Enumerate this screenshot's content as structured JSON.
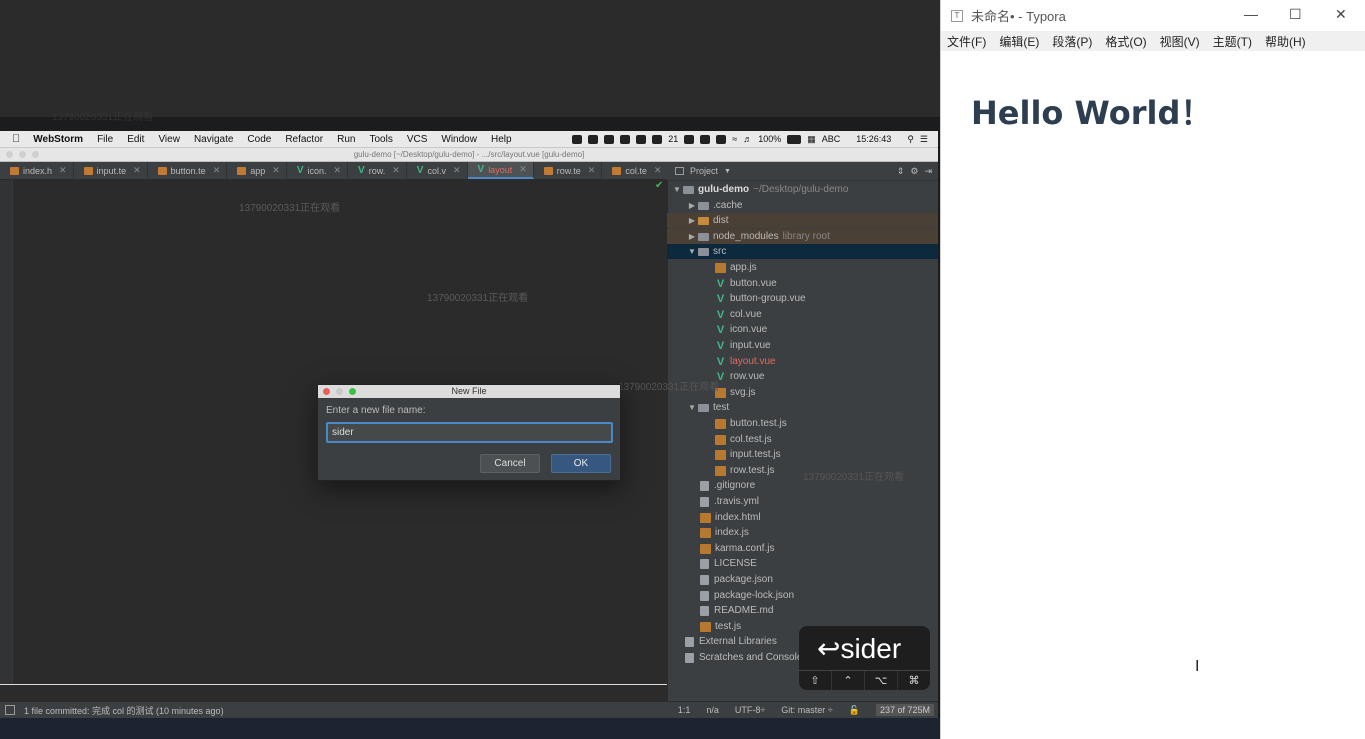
{
  "left_watermark_top": "13790020331正在观看",
  "mac_menubar": {
    "apple": "",
    "app_name": "WebStorm",
    "items": [
      "File",
      "Edit",
      "View",
      "Navigate",
      "Code",
      "Refactor",
      "Run",
      "Tools",
      "VCS",
      "Window",
      "Help"
    ],
    "tray_count": "21",
    "battery": "100%",
    "input_method": "ABC",
    "clock": "15:26:43"
  },
  "ws_window": {
    "title": "gulu-demo [~/Desktop/gulu-demo] - .../src/layout.vue [gulu-demo]"
  },
  "tabs": [
    {
      "label": "index.h",
      "icon": "js"
    },
    {
      "label": "input.te",
      "icon": "js"
    },
    {
      "label": "button.te",
      "icon": "js"
    },
    {
      "label": "app",
      "icon": "js"
    },
    {
      "label": "icon.",
      "icon": "vue"
    },
    {
      "label": "row.",
      "icon": "vue"
    },
    {
      "label": "col.v",
      "icon": "vue"
    },
    {
      "label": "layout",
      "icon": "vue",
      "active": true
    },
    {
      "label": "row.te",
      "icon": "js"
    },
    {
      "label": "col.te",
      "icon": "js"
    }
  ],
  "editor_watermarks": [
    "13790020331正在观看",
    "13790020331正在观看",
    "13790020331正在观看",
    "13790020331正在观看"
  ],
  "project": {
    "header": "Project",
    "tree": [
      {
        "label": "gulu-demo",
        "suffix": "~/Desktop/gulu-demo",
        "indent": 0,
        "arrow": "▼",
        "kind": "folder",
        "bold": true
      },
      {
        "label": ".cache",
        "indent": 1,
        "arrow": "▶",
        "kind": "folder"
      },
      {
        "label": "dist",
        "indent": 1,
        "arrow": "▶",
        "kind": "folder-orange",
        "excluded": true
      },
      {
        "label": "node_modules",
        "suffix": "library root",
        "indent": 1,
        "arrow": "▶",
        "kind": "folder",
        "excluded": true
      },
      {
        "label": "src",
        "indent": 1,
        "arrow": "▼",
        "kind": "folder",
        "selected": true
      },
      {
        "label": "app.js",
        "indent": 2,
        "kind": "js"
      },
      {
        "label": "button.vue",
        "indent": 2,
        "kind": "vue"
      },
      {
        "label": "button-group.vue",
        "indent": 2,
        "kind": "vue"
      },
      {
        "label": "col.vue",
        "indent": 2,
        "kind": "vue"
      },
      {
        "label": "icon.vue",
        "indent": 2,
        "kind": "vue"
      },
      {
        "label": "input.vue",
        "indent": 2,
        "kind": "vue"
      },
      {
        "label": "layout.vue",
        "indent": 2,
        "kind": "vue",
        "modified": true
      },
      {
        "label": "row.vue",
        "indent": 2,
        "kind": "vue"
      },
      {
        "label": "svg.js",
        "indent": 2,
        "kind": "js"
      },
      {
        "label": "test",
        "indent": 1,
        "arrow": "▼",
        "kind": "folder"
      },
      {
        "label": "button.test.js",
        "indent": 2,
        "kind": "js"
      },
      {
        "label": "col.test.js",
        "indent": 2,
        "kind": "js"
      },
      {
        "label": "input.test.js",
        "indent": 2,
        "kind": "js"
      },
      {
        "label": "row.test.js",
        "indent": 2,
        "kind": "js"
      },
      {
        "label": ".gitignore",
        "indent": 1,
        "kind": "file"
      },
      {
        "label": ".travis.yml",
        "indent": 1,
        "kind": "file"
      },
      {
        "label": "index.html",
        "indent": 1,
        "kind": "js"
      },
      {
        "label": "index.js",
        "indent": 1,
        "kind": "js"
      },
      {
        "label": "karma.conf.js",
        "indent": 1,
        "kind": "js"
      },
      {
        "label": "LICENSE",
        "indent": 1,
        "kind": "file"
      },
      {
        "label": "package.json",
        "indent": 1,
        "kind": "file"
      },
      {
        "label": "package-lock.json",
        "indent": 1,
        "kind": "file"
      },
      {
        "label": "README.md",
        "indent": 1,
        "kind": "file"
      },
      {
        "label": "test.js",
        "indent": 1,
        "kind": "js"
      },
      {
        "label": "External Libraries",
        "indent": 0,
        "kind": "file"
      },
      {
        "label": "Scratches and Consoles",
        "indent": 0,
        "kind": "file"
      }
    ]
  },
  "dialog": {
    "title": "New File",
    "prompt": "Enter a new file name:",
    "input_value": "sider",
    "cancel_label": "Cancel",
    "ok_label": "OK"
  },
  "statusbar": {
    "message": "1 file committed: 完成 col 的测试 (10 minutes ago)",
    "position": "1:1",
    "na": "n/a",
    "encoding": "UTF-8÷",
    "git": "Git: master ÷",
    "memory": "237 of 725M"
  },
  "keycast": {
    "text": "↩sider",
    "mods": [
      "⇧",
      "⌃",
      "⌥",
      "⌘"
    ]
  },
  "typora": {
    "window_title": "未命名• - Typora",
    "app_icon": "T",
    "menu": [
      "文件(F)",
      "编辑(E)",
      "段落(P)",
      "格式(O)",
      "视图(V)",
      "主题(T)",
      "帮助(H)"
    ],
    "heading": "Hello World！"
  },
  "colors": {
    "ide_bg": "#2b2b2b",
    "panel_bg": "#3c3f41",
    "accent_blue": "#4a88c7",
    "vue_green": "#41b883",
    "modified_red": "#e06c60",
    "heading_color": "#2c3e50"
  }
}
